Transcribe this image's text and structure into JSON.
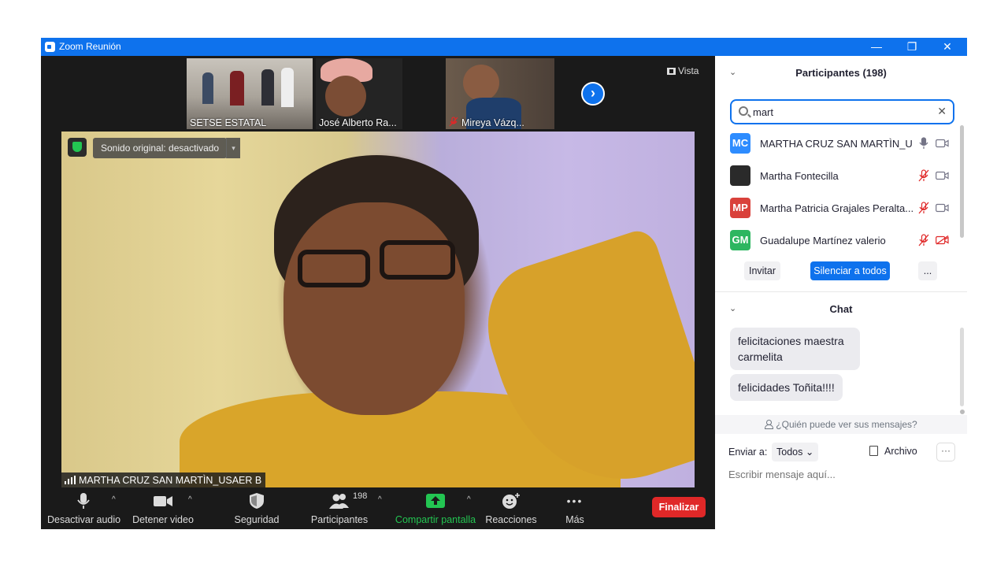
{
  "window": {
    "title": "Zoom Reunión",
    "minimize": "—",
    "maximize": "❐",
    "close": "✕"
  },
  "thumbnails": [
    {
      "name": "SETSE ESTATAL"
    },
    {
      "name": "José Alberto Ra..."
    },
    {
      "name": "Mireya Vázq..."
    }
  ],
  "view_label": "Vista",
  "next_arrow": "›",
  "main_video": {
    "sound_status": "Sonido original: desactivado",
    "caret": "▾",
    "speaker_name": "MARTHA CRUZ SAN MARTÌN_USAER B"
  },
  "toolbar": {
    "mute_audio": "Desactivar audio",
    "stop_video": "Detener video",
    "security": "Seguridad",
    "participants": "Participantes",
    "participants_count": "198",
    "share_screen": "Compartir pantalla",
    "reactions": "Reacciones",
    "more": "Más",
    "more_dots": "•••",
    "caret": "^",
    "end": "Finalizar"
  },
  "participants_panel": {
    "collapse": "⌄",
    "title": "Participantes (198)",
    "search_value": "mart",
    "search_clear": "✕",
    "participants": [
      {
        "initials": "MC",
        "name": "MARTHA CRUZ SAN MARTÌN_U...",
        "avatar_color": "#2d8cff",
        "muted": false,
        "video_off": false
      },
      {
        "initials": "",
        "name": "Martha Fontecilla",
        "avatar_color": "#2a2a2a",
        "muted": true,
        "video_off": false
      },
      {
        "initials": "MP",
        "name": "Martha Patricia Grajales Peralta...",
        "avatar_color": "#d9413b",
        "muted": true,
        "video_off": false
      },
      {
        "initials": "GM",
        "name": "Guadalupe Martínez valerio",
        "avatar_color": "#2db660",
        "muted": true,
        "video_off": true
      }
    ],
    "invite": "Invitar",
    "mute_all": "Silenciar a todos",
    "more": "..."
  },
  "chat_panel": {
    "collapse": "⌄",
    "title": "Chat",
    "messages": [
      "felicitaciones maestra carmelita",
      "felicidades Toñita!!!!"
    ],
    "who_can_see": "¿Quién puede ver sus mensajes?",
    "send_to_label": "Enviar a:",
    "send_to_value": "Todos",
    "send_to_caret": "⌄",
    "file": "Archivo",
    "more": "···",
    "input_placeholder": "Escribir mensaje aquí..."
  },
  "colors": {
    "accent": "#0e72ed",
    "end_red": "#e02828",
    "share_green": "#23c552",
    "muted_red": "#e02828"
  }
}
